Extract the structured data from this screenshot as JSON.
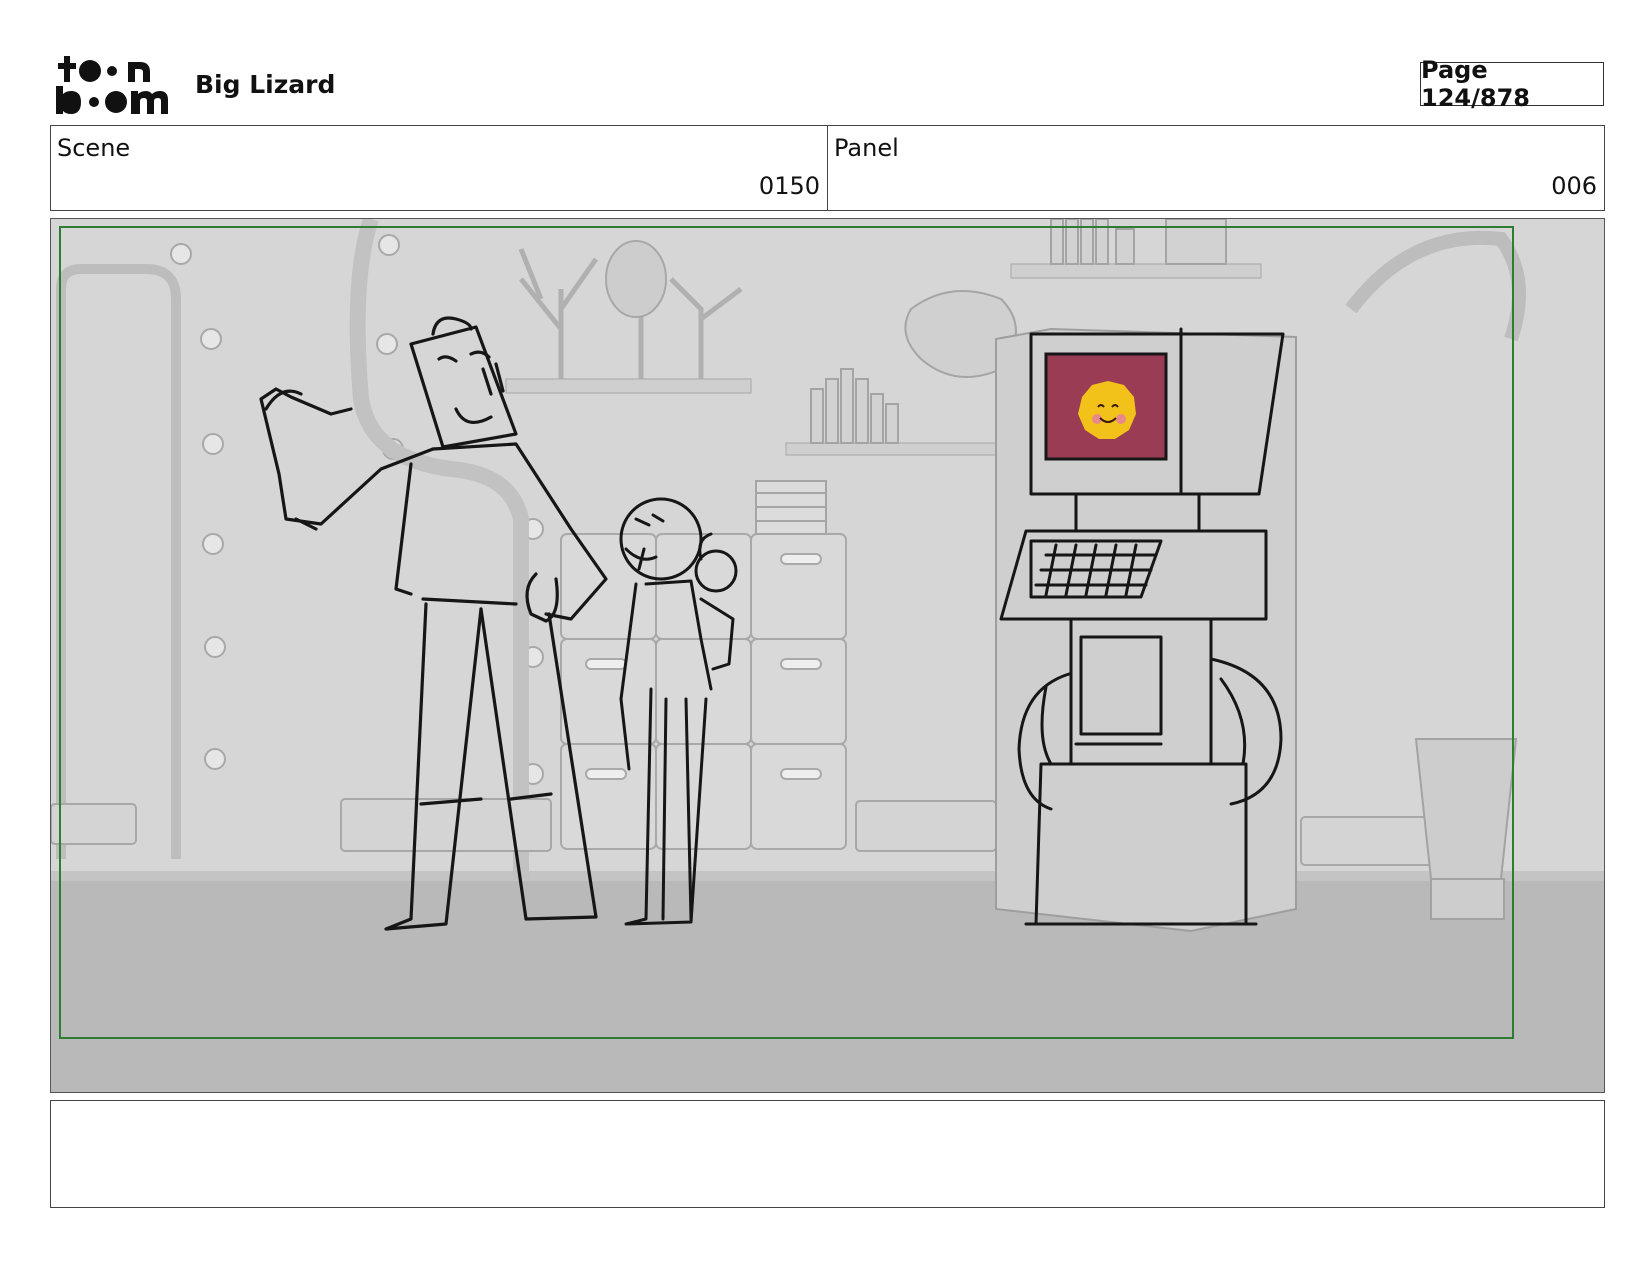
{
  "header": {
    "logo": {
      "icon": "toonboom-logo",
      "top_text": "toon",
      "bottom_text": "boom"
    },
    "project_title": "Big Lizard",
    "page_label": "Page 124/878"
  },
  "info": {
    "scene_label": "Scene",
    "scene_value": "0150",
    "panel_label": "Panel",
    "panel_value": "006"
  },
  "panel": {
    "safe_frame_color": "#2e7d32",
    "screen_color": "#9b3c55",
    "smiley_color": "#f2c21b",
    "cheek_color": "#e98a8a"
  },
  "notes": {
    "text": ""
  }
}
